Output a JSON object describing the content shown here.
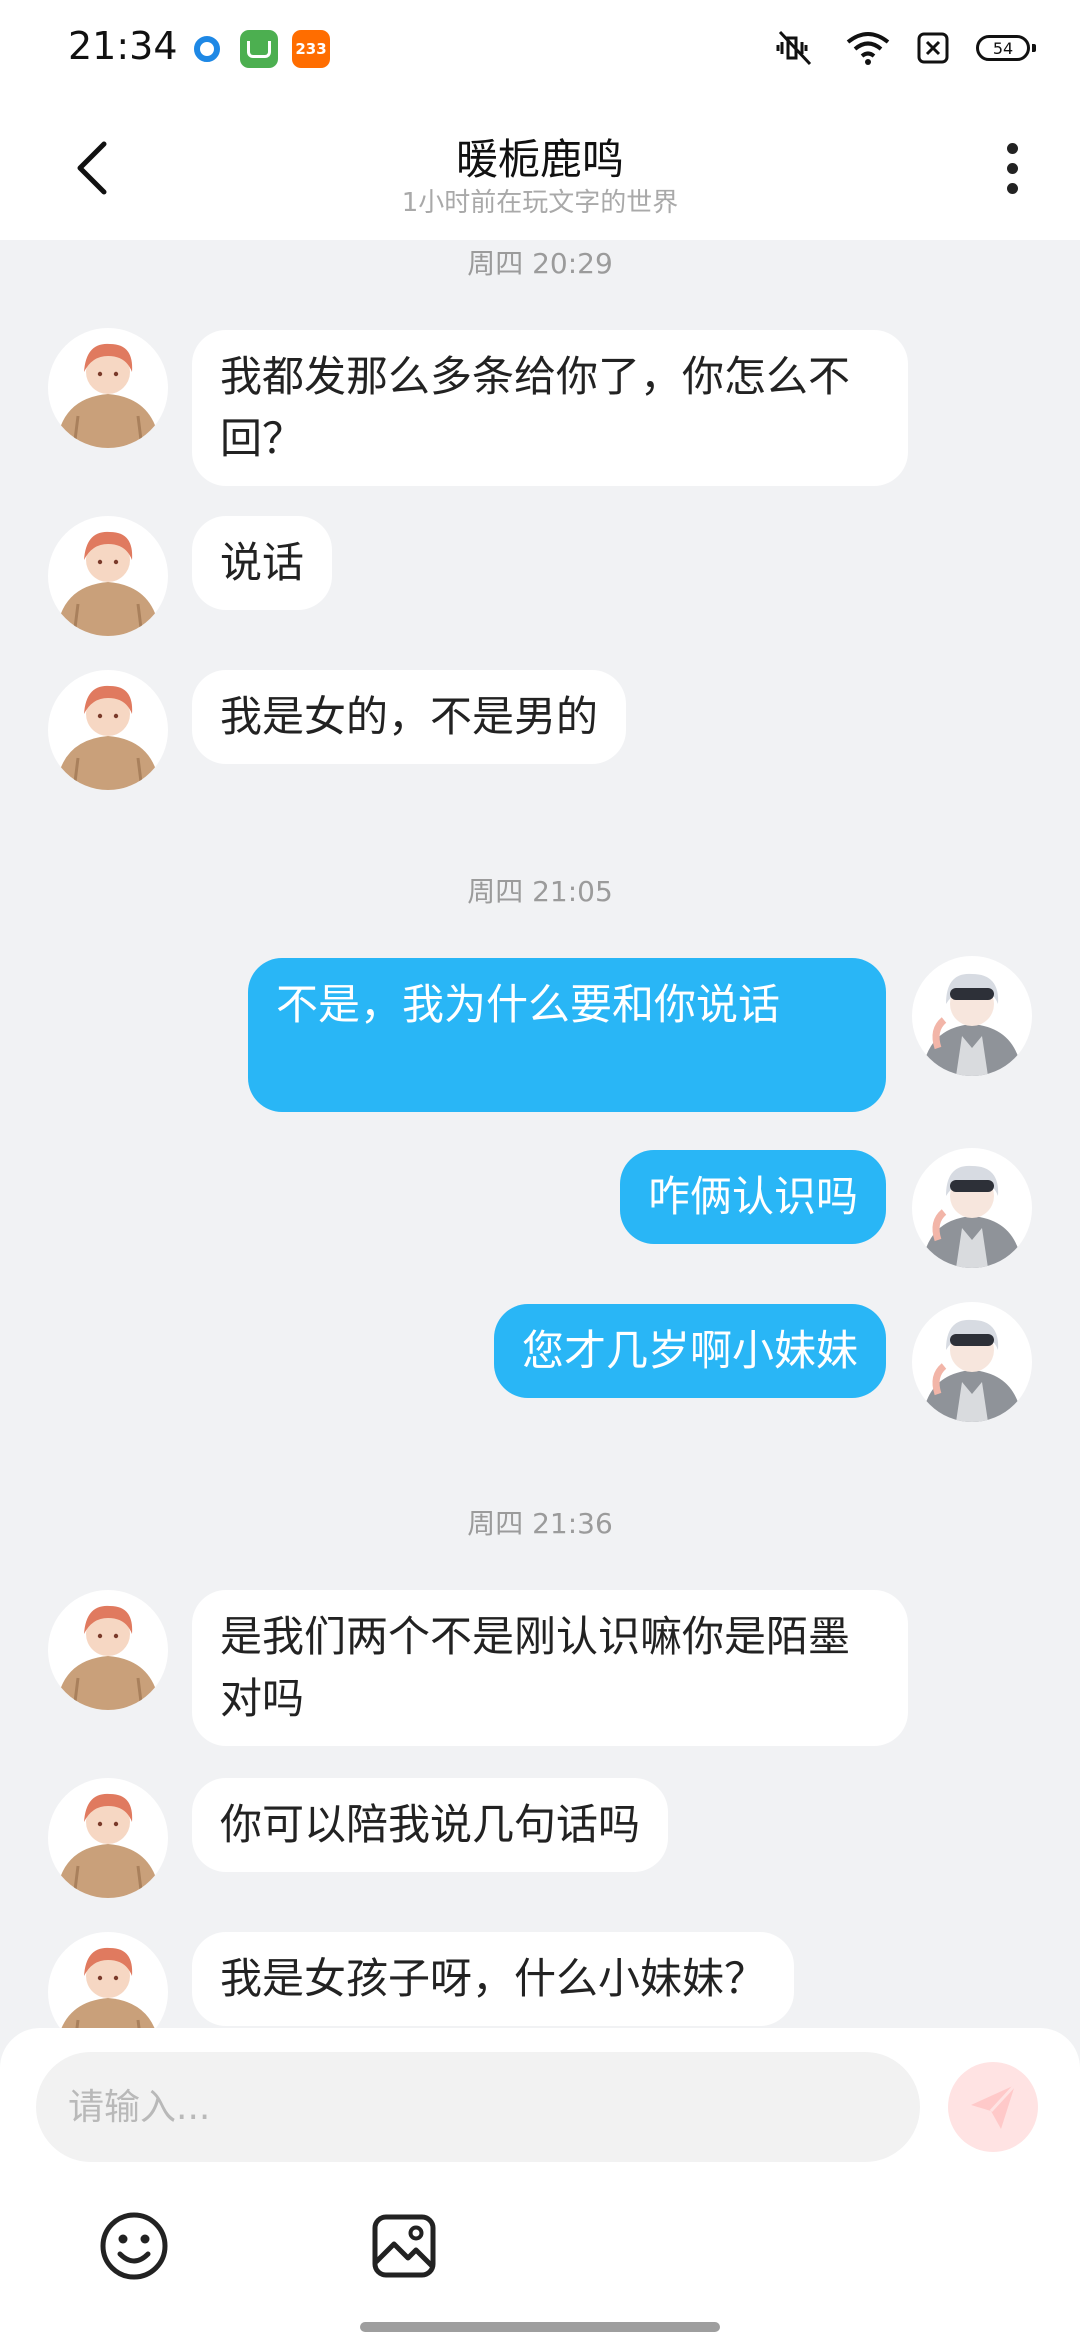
{
  "status_bar": {
    "time": "21:34",
    "notification_badge_text": "233",
    "battery_level": "54",
    "icons": [
      "blue-circle-icon",
      "green-app-icon",
      "orange-233-icon",
      "mute-vibrate-icon",
      "wifi-icon",
      "no-sim-icon",
      "battery-icon"
    ]
  },
  "header": {
    "title": "暖栀鹿鸣",
    "subtitle": "1小时前在玩文字的世界",
    "back_icon": "chevron-left-icon",
    "more_icon": "more-vertical-icon"
  },
  "messages": [
    {
      "type": "time",
      "text": "周四 20:29"
    },
    {
      "type": "in",
      "text": "我都发那么多条给你了，你怎么不回？"
    },
    {
      "type": "in",
      "text": "说话"
    },
    {
      "type": "in",
      "text": "我是女的，不是男的"
    },
    {
      "type": "time",
      "text": "周四 21:05"
    },
    {
      "type": "out",
      "text": "不是，我为什么要和你说话"
    },
    {
      "type": "out",
      "text": "咋俩认识吗"
    },
    {
      "type": "out",
      "text": "您才几岁啊小妹妹"
    },
    {
      "type": "time",
      "text": "周四 21:36"
    },
    {
      "type": "in",
      "text": "是我们两个不是刚认识嘛你是陌墨对吗"
    },
    {
      "type": "in",
      "text": "你可以陪我说几句话吗"
    },
    {
      "type": "in",
      "text": "我是女孩子呀，什么小妹妹？"
    }
  ],
  "input": {
    "placeholder": "请输入...",
    "value": ""
  },
  "toolbar": {
    "send_icon": "paper-plane-icon",
    "emoji_icon": "smiley-icon",
    "image_icon": "image-icon"
  },
  "colors": {
    "outgoing_bubble": "#29b6f6",
    "incoming_bubble": "#ffffff",
    "background": "#f1f2f4",
    "send_button": "#ffe3e3"
  }
}
